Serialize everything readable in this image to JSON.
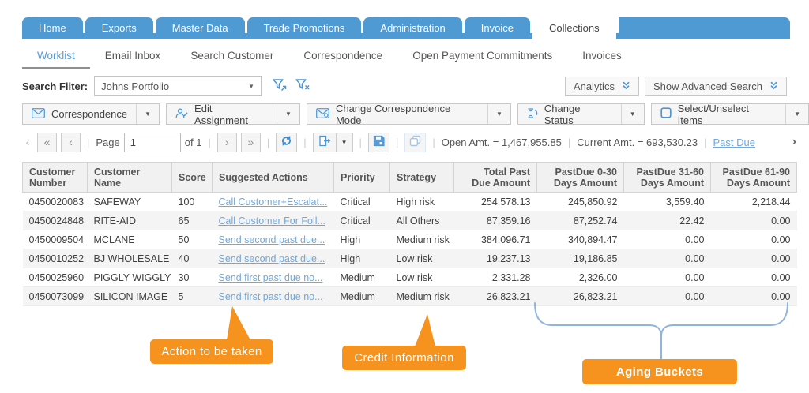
{
  "nav": {
    "tabs": [
      "Home",
      "Exports",
      "Master Data",
      "Trade Promotions",
      "Administration",
      "Invoice",
      "Collections"
    ],
    "active_tab": "Collections"
  },
  "subnav": {
    "items": [
      "Worklist",
      "Email Inbox",
      "Search Customer",
      "Correspondence",
      "Open Payment Commitments",
      "Invoices"
    ],
    "active_item": "Worklist"
  },
  "filter": {
    "label": "Search Filter:",
    "value": "Johns Portfolio",
    "analytics_label": "Analytics",
    "advanced_label": "Show Advanced Search"
  },
  "toolbar": {
    "buttons": [
      "Correspondence",
      "Edit Assignment",
      "Change Correspondence Mode",
      "Change Status",
      "Select/Unselect Items"
    ]
  },
  "pager": {
    "page_label": "Page",
    "page_value": "1",
    "of_label": "of 1",
    "open_amt": "Open Amt. = 1,467,955.85",
    "current_amt": "Current Amt. = 693,530.23",
    "past_due_label": "Past Due"
  },
  "table": {
    "columns": [
      {
        "key": "number",
        "label": "Customer\nNumber",
        "align": "left"
      },
      {
        "key": "name",
        "label": "Customer\nName",
        "align": "left"
      },
      {
        "key": "score",
        "label": "Score",
        "align": "left"
      },
      {
        "key": "action",
        "label": "Suggested Actions",
        "align": "left"
      },
      {
        "key": "priority",
        "label": "Priority",
        "align": "left"
      },
      {
        "key": "strategy",
        "label": "Strategy",
        "align": "left"
      },
      {
        "key": "total",
        "label": "Total Past\nDue Amount",
        "align": "right"
      },
      {
        "key": "d0_30",
        "label": "PastDue 0-30\nDays Amount",
        "align": "right"
      },
      {
        "key": "d31_60",
        "label": "PastDue 31-60\nDays Amount",
        "align": "right"
      },
      {
        "key": "d61_90",
        "label": "PastDue 61-90\nDays Amount",
        "align": "right"
      }
    ],
    "rows": [
      {
        "number": "0450020083",
        "name": "SAFEWAY",
        "score": "100",
        "action": "Call Customer+Escalat...",
        "priority": "Critical",
        "strategy": "High risk",
        "total": "254,578.13",
        "d0_30": "245,850.92",
        "d31_60": "3,559.40",
        "d61_90": "2,218.44"
      },
      {
        "number": "0450024848",
        "name": "RITE-AID",
        "score": "65",
        "action": "Call Customer For Foll...",
        "priority": "Critical",
        "strategy": "All Others",
        "total": "87,359.16",
        "d0_30": "87,252.74",
        "d31_60": "22.42",
        "d61_90": "0.00"
      },
      {
        "number": "0450009504",
        "name": "MCLANE",
        "score": "50",
        "action": "Send second past due...",
        "priority": "High",
        "strategy": "Medium risk",
        "total": "384,096.71",
        "d0_30": "340,894.47",
        "d31_60": "0.00",
        "d61_90": "0.00"
      },
      {
        "number": "0450010252",
        "name": "BJ WHOLESALE",
        "score": "40",
        "action": "Send second past due...",
        "priority": "High",
        "strategy": "Low risk",
        "total": "19,237.13",
        "d0_30": "19,186.85",
        "d31_60": "0.00",
        "d61_90": "0.00"
      },
      {
        "number": "0450025960",
        "name": "PIGGLY WIGGLY",
        "score": "30",
        "action": "Send first past due no...",
        "priority": "Medium",
        "strategy": "Low risk",
        "total": "2,331.28",
        "d0_30": "2,326.00",
        "d31_60": "0.00",
        "d61_90": "0.00"
      },
      {
        "number": "0450073099",
        "name": "SILICON IMAGE",
        "score": "5",
        "action": "Send first past due no...",
        "priority": "Medium",
        "strategy": "Medium risk",
        "total": "26,823.21",
        "d0_30": "26,823.21",
        "d31_60": "0.00",
        "d61_90": "0.00"
      }
    ]
  },
  "callouts": {
    "action": "Action to be taken",
    "credit": "Credit Information",
    "aging": "Aging Buckets"
  },
  "colors": {
    "nav_blue": "#4f9ad3",
    "link_blue": "#71a7da",
    "icon_blue": "#4d96d2",
    "callout_orange": "#f6921e"
  }
}
